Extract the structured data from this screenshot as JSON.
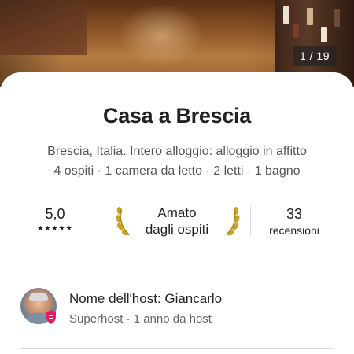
{
  "photo": {
    "counter": "1 / 19"
  },
  "listing": {
    "title": "Casa a Brescia",
    "subtitle": "Brescia, Italia. Intero alloggio: alloggio in affitto",
    "details": [
      "4 ospiti",
      "1 camera da letto",
      "2 letti",
      "1 bagno"
    ],
    "details_separator": " · "
  },
  "stats": {
    "rating": "5,0",
    "stars": "★★★★★",
    "stars_value": 5,
    "guest_favorite_line1": "Amato",
    "guest_favorite_line2": "dagli ospiti",
    "reviews_count": "33",
    "reviews_label": "recensioni"
  },
  "host": {
    "name": "Nome dell'host: Giancarlo",
    "meta": "Superhost · 1 anno da host"
  },
  "icons": {
    "laurel_left": "laurel-left-icon",
    "laurel_right": "laurel-right-icon",
    "superhost": "superhost-badge-icon"
  },
  "colors": {
    "laurel": "#C9A227",
    "superhost": "#E31C5F",
    "text": "#222222",
    "muted": "#666666"
  }
}
